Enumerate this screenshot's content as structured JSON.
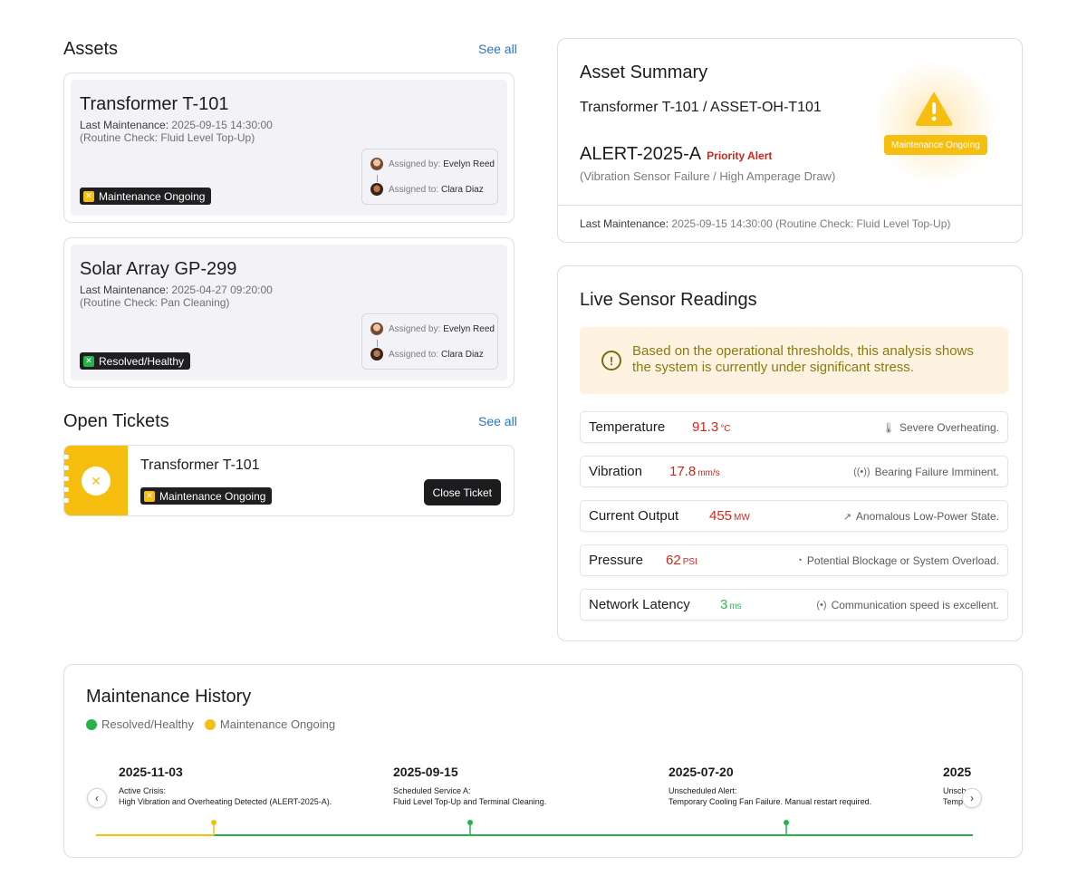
{
  "assets": {
    "title": "Assets",
    "see_all": "See all",
    "items": [
      {
        "name": "Transformer T-101",
        "last_label": "Last Maintenance:",
        "last_value": "2025-09-15 14:30:00",
        "note": "(Routine Check: Fluid Level Top-Up)",
        "status": "Maintenance Ongoing",
        "status_color": "#f6bf10",
        "assigned_by_label": "Assigned by:",
        "assigned_by": "Evelyn Reed",
        "assigned_to_label": "Assigned to:",
        "assigned_to": "Clara Diaz"
      },
      {
        "name": "Solar Array GP-299",
        "last_label": "Last Maintenance:",
        "last_value": "2025-04-27 09:20:00",
        "note": "(Routine Check: Pan Cleaning)",
        "status": "Resolved/Healthy",
        "status_color": "#27b34a",
        "assigned_by_label": "Assigned by:",
        "assigned_by": "Evelyn Reed",
        "assigned_to_label": "Assigned to:",
        "assigned_to": "Clara Diaz"
      }
    ]
  },
  "tickets": {
    "title": "Open Tickets",
    "see_all": "See all",
    "items": [
      {
        "name": "Transformer T-101",
        "status": "Maintenance Ongoing",
        "action": "Close Ticket"
      }
    ]
  },
  "summary": {
    "title": "Asset Summary",
    "asset": "Transformer T-101 / ASSET-OH-T101",
    "alert_id": "ALERT-2025-A",
    "priority": "Priority Alert",
    "description": "(Vibration Sensor Failure / High Amperage Draw)",
    "badge": "Maintenance Ongoing",
    "last_label": "Last Maintenance:",
    "last_value": "2025-09-15 14:30:00 (Routine Check: Fluid Level Top-Up)"
  },
  "live": {
    "title": "Live Sensor Readings",
    "notice": "Based on the operational thresholds, this analysis shows the system is currently under significant stress.",
    "sensors": [
      {
        "name": "Temperature",
        "value": "91.3",
        "unit": "°C",
        "note": "Severe Overheating.",
        "icon": "thermometer-icon"
      },
      {
        "name": "Vibration",
        "value": "17.8",
        "unit": "mm/s",
        "note": "Bearing Failure Imminent.",
        "icon": "vibration-icon"
      },
      {
        "name": "Current Output",
        "value": "455",
        "unit": "MW",
        "note": "Anomalous Low-Power State.",
        "icon": "trend-icon"
      },
      {
        "name": "Pressure",
        "value": "62",
        "unit": "PSI",
        "note": "Potential Blockage or System Overload.",
        "icon": "gauge-icon"
      },
      {
        "name": "Network Latency",
        "value": "3",
        "unit": "ms",
        "note": "Communication speed is excellent.",
        "icon": "signal-icon"
      }
    ]
  },
  "history": {
    "title": "Maintenance History",
    "legend": [
      {
        "label": "Resolved/Healthy",
        "color": "#27b34a"
      },
      {
        "label": "Maintenance Ongoing",
        "color": "#f6bf10"
      }
    ],
    "events": [
      {
        "date": "2025-11-03",
        "head": "Active Crisis:",
        "desc": "High Vibration and Overheating Detected (ALERT-2025-A)."
      },
      {
        "date": "2025-09-15",
        "head": "Scheduled Service A:",
        "desc": "Fluid Level Top-Up and Terminal Cleaning."
      },
      {
        "date": "2025-07-20",
        "head": "Unscheduled Alert:",
        "desc": "Temporary Cooling Fan Failure. Manual restart required."
      },
      {
        "date": "2025",
        "head": "Unsch",
        "desc": "Temp"
      }
    ]
  }
}
